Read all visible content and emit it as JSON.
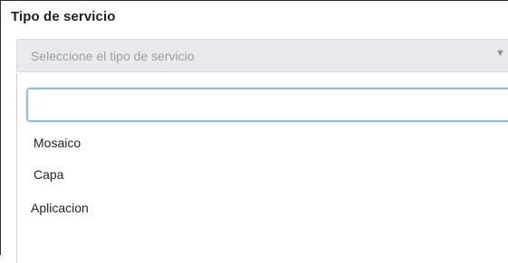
{
  "field": {
    "label": "Tipo de servicio"
  },
  "select": {
    "placeholder": "Seleccione el tipo de servicio",
    "arrow_icon": "caret-down-icon"
  },
  "dropdown": {
    "search_value": "",
    "options": [
      {
        "label": "Mosaico"
      },
      {
        "label": "Capa"
      },
      {
        "label": "Aplicacion"
      }
    ]
  },
  "colors": {
    "select_background": "#e7e9ec",
    "search_focus_border": "#8fbde3",
    "placeholder_text": "#9aa0a6"
  }
}
